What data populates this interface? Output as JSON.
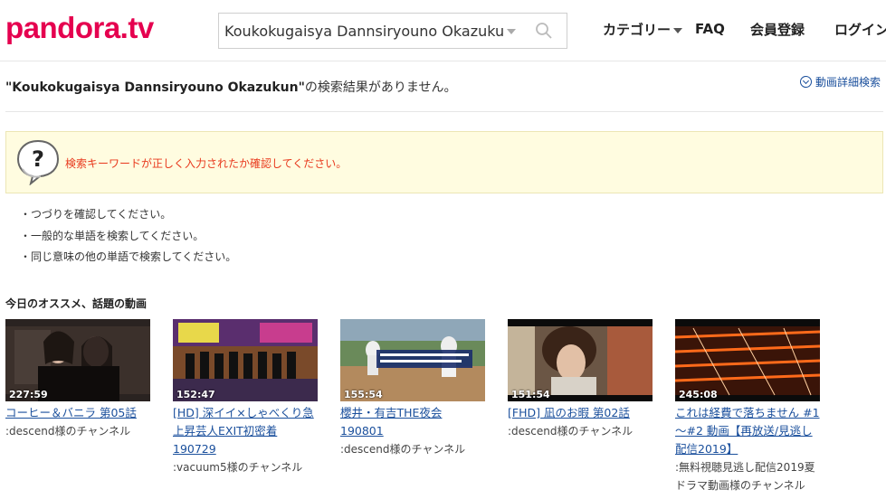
{
  "header": {
    "logo": "pandora.tv",
    "search_value": "Koukokugaisya Dannsiryouno Okazukun",
    "nav": {
      "category": "カテゴリー",
      "faq": "FAQ",
      "register": "会員登録",
      "login": "ログイン"
    }
  },
  "result": {
    "query": "\"Koukokugaisya Dannsiryouno Okazukun\"",
    "message": "の検索結果がありません。",
    "detail_link": "動画詳細検索"
  },
  "notice": {
    "text": "検索キーワードが正しく入力されたか確認してください。"
  },
  "tips": [
    "・つづりを確認してください。",
    "・一般的な単語を検索してください。",
    "・同じ意味の他の単語で検索してください。"
  ],
  "recommend": {
    "title": "今日のオススメ、話題の動画",
    "videos": [
      {
        "duration": "227:59",
        "title": "コーヒー＆バニラ 第05話",
        "channel": ":descend様のチャンネル"
      },
      {
        "duration": "152:47",
        "title": "[HD] 深イイ×しゃべくり急上昇芸人EXIT初密着190729",
        "channel": ":vacuum5様のチャンネル"
      },
      {
        "duration": "155:54",
        "title": "櫻井・有吉THE夜会190801",
        "channel": ":descend様のチャンネル"
      },
      {
        "duration": "151:54",
        "title": "[FHD] 凪のお暇 第02話",
        "channel": ":descend様のチャンネル"
      },
      {
        "duration": "245:08",
        "title": "これは経費で落ちません #1～#2 動画【再放送/見逃し配信2019】",
        "channel": ":無料視聴見逃し配信2019夏ドラマ動画様のチャンネル"
      }
    ]
  },
  "colors": {
    "brand": "#e5004f",
    "link": "#1a4f9c",
    "notice_text": "#e8391d",
    "notice_bg": "#fffce0"
  }
}
